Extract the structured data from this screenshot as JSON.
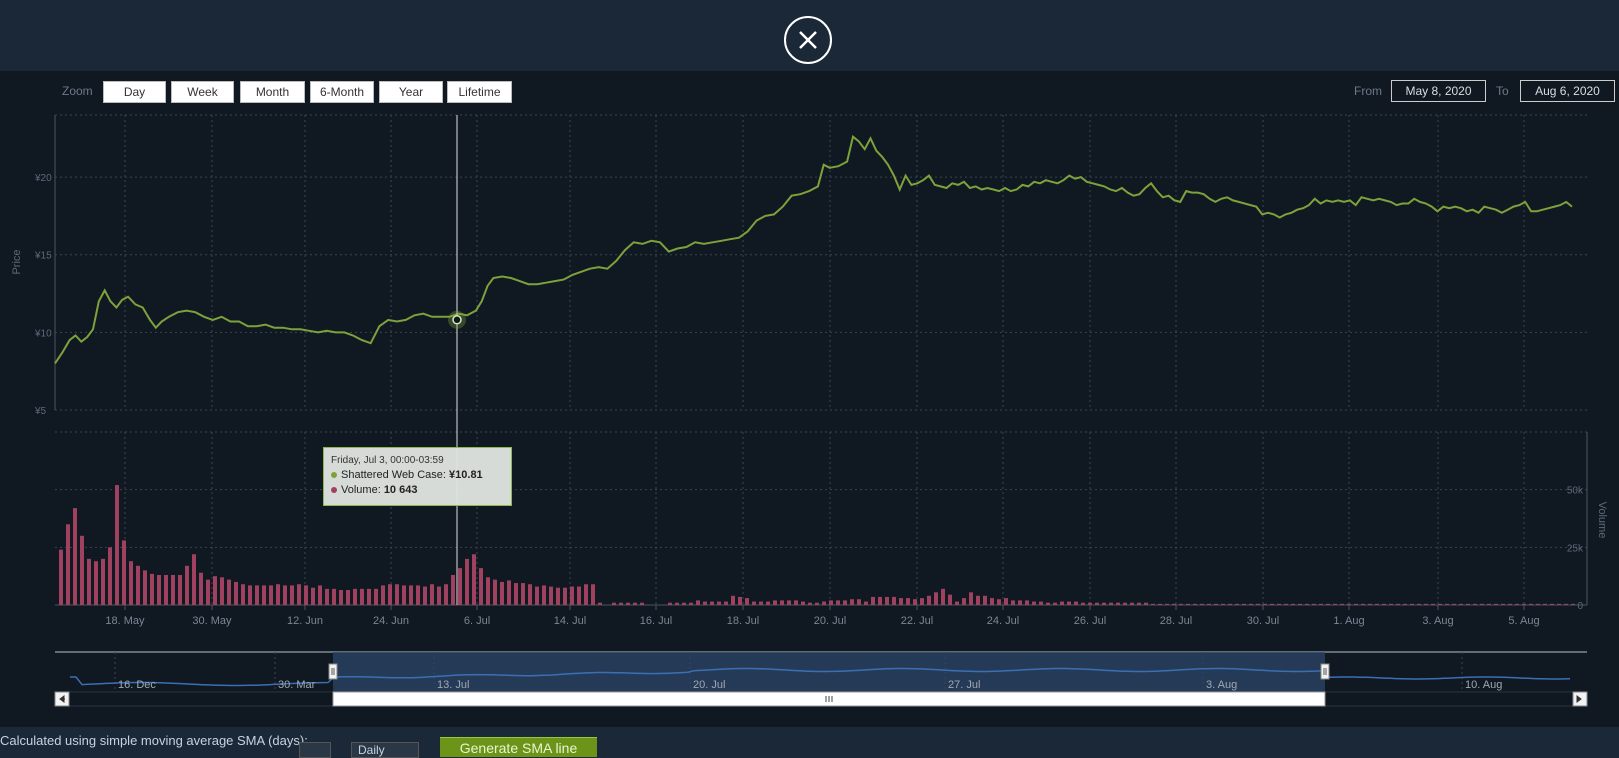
{
  "close": {
    "icon": "close-icon"
  },
  "zoom": {
    "label": "Zoom",
    "buttons": [
      "Day",
      "Week",
      "Month",
      "6-Month",
      "Year",
      "Lifetime"
    ]
  },
  "range": {
    "from_label": "From",
    "from": "May 8, 2020",
    "to_label": "To",
    "to": "Aug 6, 2020"
  },
  "tooltip": {
    "date": "Friday, Jul 3, 00:00-03:59",
    "series_name": "Shattered Web Case:",
    "price": "¥10.81",
    "volume_label": "Volume:",
    "volume": "10 643"
  },
  "colors": {
    "price_line": "#7da23b",
    "volume_bars": "#a0415f",
    "navigator_line": "#3b6fb3",
    "navigator_mask": "#2c4569",
    "grid": "#3a4450"
  },
  "chart_data": [
    {
      "type": "line",
      "series": [
        {
          "name": "Shattered Web Case",
          "unit": "¥"
        }
      ],
      "ylabel": "Price",
      "ylim": [
        5,
        24
      ],
      "yticks": [
        "¥5",
        "¥10",
        "¥15",
        "¥20"
      ],
      "xticks": [
        "18. May",
        "30. May",
        "12. Jun",
        "24. Jun",
        "6. Jul",
        "14. Jul",
        "16. Jul",
        "18. Jul",
        "20. Jul",
        "22. Jul",
        "24. Jul",
        "26. Jul",
        "28. Jul",
        "30. Jul",
        "1. Aug",
        "3. Aug",
        "5. Aug"
      ],
      "points": [
        [
          0,
          8.0
        ],
        [
          5,
          8.7
        ],
        [
          10,
          9.5
        ],
        [
          14,
          9.8
        ],
        [
          18,
          9.4
        ],
        [
          22,
          9.7
        ],
        [
          26,
          10.2
        ],
        [
          30,
          12.0
        ],
        [
          34,
          12.7
        ],
        [
          38,
          12.0
        ],
        [
          42,
          11.6
        ],
        [
          46,
          12.1
        ],
        [
          50,
          12.3
        ],
        [
          55,
          11.8
        ],
        [
          60,
          11.6
        ],
        [
          65,
          10.8
        ],
        [
          69,
          10.3
        ],
        [
          73,
          10.7
        ],
        [
          78,
          11.0
        ],
        [
          84,
          11.3
        ],
        [
          90,
          11.4
        ],
        [
          96,
          11.3
        ],
        [
          102,
          11.0
        ],
        [
          108,
          10.8
        ],
        [
          114,
          11.0
        ],
        [
          120,
          10.7
        ],
        [
          126,
          10.7
        ],
        [
          132,
          10.4
        ],
        [
          138,
          10.4
        ],
        [
          144,
          10.5
        ],
        [
          150,
          10.3
        ],
        [
          156,
          10.3
        ],
        [
          162,
          10.2
        ],
        [
          168,
          10.2
        ],
        [
          174,
          10.1
        ],
        [
          180,
          10.0
        ],
        [
          186,
          10.1
        ],
        [
          192,
          10.0
        ],
        [
          198,
          10.0
        ],
        [
          204,
          9.8
        ],
        [
          210,
          9.5
        ],
        [
          216,
          9.3
        ],
        [
          222,
          10.4
        ],
        [
          228,
          10.8
        ],
        [
          234,
          10.7
        ],
        [
          240,
          10.8
        ],
        [
          246,
          11.1
        ],
        [
          252,
          11.2
        ],
        [
          258,
          11.0
        ],
        [
          264,
          11.0
        ],
        [
          270,
          11.0
        ],
        [
          276,
          11.2
        ],
        [
          282,
          11.1
        ],
        [
          288,
          11.4
        ],
        [
          292,
          12.0
        ],
        [
          296,
          13.0
        ],
        [
          300,
          13.5
        ],
        [
          306,
          13.6
        ],
        [
          312,
          13.5
        ],
        [
          318,
          13.3
        ],
        [
          324,
          13.1
        ],
        [
          330,
          13.1
        ],
        [
          336,
          13.2
        ],
        [
          342,
          13.3
        ],
        [
          348,
          13.4
        ],
        [
          354,
          13.7
        ],
        [
          360,
          13.9
        ],
        [
          366,
          14.1
        ],
        [
          372,
          14.2
        ],
        [
          378,
          14.1
        ],
        [
          384,
          14.6
        ],
        [
          390,
          15.3
        ],
        [
          396,
          15.8
        ],
        [
          402,
          15.7
        ],
        [
          408,
          15.9
        ],
        [
          414,
          15.8
        ],
        [
          420,
          15.2
        ],
        [
          426,
          15.4
        ],
        [
          432,
          15.5
        ],
        [
          438,
          15.8
        ],
        [
          444,
          15.7
        ],
        [
          450,
          15.8
        ],
        [
          456,
          15.9
        ],
        [
          462,
          16.0
        ],
        [
          468,
          16.1
        ],
        [
          474,
          16.5
        ],
        [
          480,
          17.2
        ],
        [
          486,
          17.5
        ],
        [
          492,
          17.6
        ],
        [
          498,
          18.1
        ],
        [
          504,
          18.8
        ],
        [
          510,
          18.9
        ],
        [
          516,
          19.1
        ],
        [
          522,
          19.4
        ],
        [
          526,
          20.8
        ],
        [
          530,
          20.6
        ],
        [
          536,
          20.7
        ],
        [
          542,
          21.0
        ],
        [
          546,
          22.6
        ],
        [
          550,
          22.3
        ],
        [
          554,
          21.8
        ],
        [
          558,
          22.5
        ],
        [
          562,
          21.7
        ],
        [
          566,
          21.3
        ],
        [
          570,
          20.8
        ],
        [
          574,
          20.1
        ],
        [
          578,
          19.2
        ],
        [
          582,
          20.1
        ],
        [
          586,
          19.5
        ],
        [
          590,
          19.6
        ],
        [
          594,
          19.8
        ],
        [
          598,
          20.1
        ],
        [
          602,
          19.5
        ],
        [
          606,
          19.4
        ],
        [
          610,
          19.3
        ],
        [
          614,
          19.6
        ],
        [
          618,
          19.5
        ],
        [
          622,
          19.7
        ],
        [
          626,
          19.3
        ],
        [
          630,
          19.4
        ],
        [
          634,
          19.2
        ],
        [
          638,
          19.3
        ],
        [
          642,
          19.2
        ],
        [
          646,
          19.1
        ],
        [
          650,
          19.3
        ],
        [
          654,
          19.1
        ],
        [
          658,
          19.2
        ],
        [
          662,
          19.5
        ],
        [
          666,
          19.4
        ],
        [
          670,
          19.7
        ],
        [
          674,
          19.6
        ],
        [
          678,
          19.8
        ],
        [
          682,
          19.7
        ],
        [
          686,
          19.6
        ],
        [
          690,
          19.8
        ],
        [
          694,
          20.1
        ],
        [
          698,
          19.9
        ],
        [
          702,
          20.0
        ],
        [
          706,
          19.7
        ],
        [
          710,
          19.6
        ],
        [
          714,
          19.5
        ],
        [
          718,
          19.4
        ],
        [
          722,
          19.2
        ],
        [
          726,
          19.1
        ],
        [
          730,
          19.3
        ],
        [
          734,
          19.0
        ],
        [
          738,
          18.8
        ],
        [
          742,
          18.9
        ],
        [
          746,
          19.3
        ],
        [
          750,
          19.6
        ],
        [
          754,
          19.1
        ],
        [
          758,
          18.7
        ],
        [
          762,
          18.8
        ],
        [
          766,
          18.5
        ],
        [
          770,
          18.4
        ],
        [
          774,
          19.1
        ],
        [
          778,
          19.0
        ],
        [
          782,
          19.0
        ],
        [
          786,
          18.9
        ],
        [
          790,
          18.6
        ],
        [
          794,
          18.4
        ],
        [
          798,
          18.6
        ],
        [
          802,
          18.7
        ],
        [
          806,
          18.5
        ],
        [
          810,
          18.4
        ],
        [
          814,
          18.3
        ],
        [
          818,
          18.2
        ],
        [
          822,
          18.1
        ],
        [
          826,
          17.6
        ],
        [
          830,
          17.7
        ],
        [
          834,
          17.6
        ],
        [
          838,
          17.4
        ],
        [
          842,
          17.6
        ],
        [
          846,
          17.7
        ],
        [
          850,
          17.9
        ],
        [
          854,
          18.0
        ],
        [
          858,
          18.2
        ],
        [
          862,
          18.6
        ],
        [
          866,
          18.3
        ],
        [
          870,
          18.5
        ],
        [
          874,
          18.4
        ],
        [
          878,
          18.5
        ],
        [
          882,
          18.4
        ],
        [
          886,
          18.5
        ],
        [
          890,
          18.2
        ],
        [
          894,
          18.7
        ],
        [
          898,
          18.6
        ],
        [
          902,
          18.5
        ],
        [
          906,
          18.6
        ],
        [
          910,
          18.5
        ],
        [
          914,
          18.4
        ],
        [
          918,
          18.2
        ],
        [
          922,
          18.3
        ],
        [
          926,
          18.3
        ],
        [
          930,
          18.6
        ],
        [
          934,
          18.4
        ],
        [
          938,
          18.3
        ],
        [
          942,
          18.1
        ],
        [
          946,
          17.8
        ],
        [
          950,
          18.1
        ],
        [
          954,
          18.0
        ],
        [
          958,
          18.1
        ],
        [
          962,
          18.0
        ],
        [
          966,
          17.8
        ],
        [
          970,
          17.9
        ],
        [
          974,
          17.7
        ],
        [
          978,
          18.1
        ],
        [
          982,
          18.0
        ],
        [
          986,
          17.9
        ],
        [
          990,
          17.7
        ],
        [
          994,
          17.9
        ],
        [
          998,
          18.1
        ],
        [
          1002,
          18.2
        ],
        [
          1006,
          18.4
        ],
        [
          1010,
          17.8
        ],
        [
          1014,
          17.8
        ],
        [
          1018,
          17.9
        ],
        [
          1022,
          18.0
        ],
        [
          1026,
          18.1
        ],
        [
          1030,
          18.2
        ],
        [
          1034,
          18.4
        ],
        [
          1038,
          18.1
        ]
      ]
    },
    {
      "type": "bar",
      "series": [
        {
          "name": "Volume"
        }
      ],
      "ylabel": "Volume",
      "ylim": [
        0,
        75000
      ],
      "yticks": [
        "0",
        "25k",
        "50k"
      ],
      "values": [
        24000,
        35000,
        42000,
        30000,
        20000,
        19000,
        20000,
        25000,
        52000,
        28000,
        19000,
        17000,
        15000,
        13500,
        13000,
        13000,
        13000,
        13000,
        17000,
        22000,
        14000,
        11000,
        12500,
        12000,
        11000,
        10000,
        9000,
        8500,
        8500,
        8500,
        8500,
        9000,
        8500,
        8500,
        9000,
        8500,
        7500,
        8500,
        7000,
        7000,
        6500,
        6500,
        7000,
        7000,
        7000,
        7000,
        8500,
        9000,
        9000,
        8500,
        8500,
        8500,
        8000,
        9000,
        8000,
        9000,
        13000,
        16000,
        20000,
        22000,
        16000,
        12000,
        11000,
        10000,
        10643,
        9500,
        9500,
        9000,
        8000,
        8500,
        8000,
        7500,
        7500,
        8000,
        8000,
        9000,
        9000,
        1000,
        0,
        1000,
        1000,
        1000,
        1000,
        1000,
        0,
        0,
        0,
        1000,
        1000,
        1000,
        1000,
        2000,
        1500,
        1500,
        1500,
        1500,
        4000,
        3500,
        3000,
        1500,
        1500,
        1500,
        2000,
        2000,
        2000,
        2000,
        1500,
        1000,
        1000,
        1500,
        2000,
        2000,
        2000,
        2500,
        2500,
        1500,
        3500,
        3500,
        3500,
        3500,
        3000,
        3000,
        2500,
        3000,
        4000,
        5500,
        7000,
        4500,
        1500,
        3000,
        5500,
        4000,
        4000,
        3000,
        2500,
        3000,
        2000,
        2000,
        2000,
        1500,
        1500,
        1000,
        1000,
        1500,
        1500,
        1500,
        1000,
        1000,
        1000,
        1000,
        1000,
        1000,
        1000,
        1000,
        1000,
        1000,
        500,
        500,
        500,
        500,
        500,
        500,
        500,
        500,
        500,
        500,
        500,
        500,
        500,
        500,
        500,
        500,
        500,
        500,
        500,
        500,
        500,
        500,
        500,
        500,
        500,
        500,
        500,
        500,
        500,
        500,
        500,
        500,
        500,
        500,
        500,
        500,
        500,
        500,
        500,
        500,
        500,
        500,
        500,
        500,
        500,
        500,
        500,
        500,
        500,
        500,
        500,
        500,
        500,
        500,
        500,
        500,
        500,
        500,
        500,
        500,
        500,
        500,
        500,
        500,
        500,
        500,
        500,
        500,
        500,
        500,
        500,
        500
      ]
    },
    {
      "type": "area",
      "series": [
        {
          "name": "Navigator"
        }
      ],
      "xticks": [
        "16. Dec",
        "30. Mar",
        "13. Jul",
        "20. Jul",
        "27. Jul",
        "3. Aug",
        "10. Aug"
      ]
    }
  ],
  "sma": {
    "text": "Calculated using simple moving average SMA (days):",
    "select_value": "Daily",
    "button": "Generate SMA line"
  }
}
